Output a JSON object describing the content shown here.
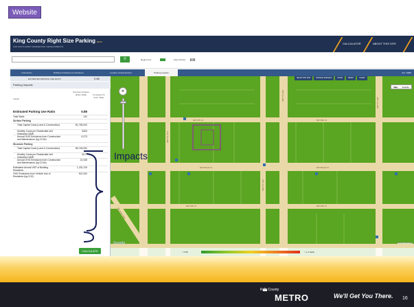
{
  "slide": {
    "badge": "Website",
    "annotation": "Impacts",
    "footer": {
      "logo_top": "King County",
      "logo_bottom": "METRO",
      "tagline": "We'll Get You There.",
      "page_number": "16"
    }
  },
  "app": {
    "title": "King County Right Size Parking",
    "beta": "BETA",
    "subtitle": "FOR MULTI-FAMILY RESIDENTIAL DEVELOPMENTS",
    "topnav": [
      "CALCULATOR",
      "ABOUT THIS SITE"
    ],
    "search": {
      "placeholder": "",
      "button_icon": "search-icon"
    },
    "legend": [
      {
        "label": "Region Ave",
        "color": "#3a9a3a"
      },
      {
        "label": "Zone Priority",
        "color": "#555555"
      }
    ],
    "tabs": [
      {
        "label": "Instructions",
        "active": false
      },
      {
        "label": "Building & Parking Combinations",
        "active": false
      },
      {
        "label": "Location Characteristics",
        "active": false
      },
      {
        "label": "Parking Impacts",
        "active": true
      }
    ],
    "all_tabs_label": "ALL TABS",
    "map_toolbar": [
      "SELECTION MAP",
      "MANAGE PARCELS",
      "ZOOM",
      "RESET",
      "CLEAR"
    ],
    "map_type": [
      "Map",
      "Satellite"
    ]
  },
  "panel": {
    "header_label": "ESTIMATED PARKING USE RATIO",
    "header_value": "0.88",
    "title": "Parking Impacts",
    "col_heads": [
      "Impact",
      "Scenario Analysis (Enter Data)",
      "Compared To Scen. Base"
    ],
    "rows": [
      {
        "label": "Estimated Parking Use Ratio",
        "value": "0.88",
        "kind": "highlight"
      },
      {
        "label": "Total Stalls",
        "value": "132",
        "kind": "normal"
      },
      {
        "label": "Surface Parking",
        "value": "",
        "kind": "section"
      },
      {
        "label": "Total Capital Costs (Land & Construction)",
        "value": "$1,755,000",
        "kind": "sub"
      },
      {
        "label": "Monthly Costs per Residential Unit (including O&M)",
        "value": "$153",
        "kind": "sub"
      },
      {
        "label": "Annual GHG Emissions from Construction and Maintenance (kg CO2e)",
        "value": "6,373",
        "kind": "sub"
      },
      {
        "label": "Structure Parking",
        "value": "",
        "kind": "section"
      },
      {
        "label": "Total Capital Costs (Land & Construction)",
        "value": "$5,745,000",
        "kind": "sub"
      },
      {
        "label": "Monthly Costs per Residential Unit (including O&M)",
        "value": "$177",
        "kind": "sub"
      },
      {
        "label": "Annual GHG Emissions from Construction and Maintenance (kg CO2e)",
        "value": "22,338",
        "kind": "sub"
      },
      {
        "label": "Estimated Annual VMT of Building Residents",
        "value": "1,232,125",
        "kind": "normal"
      },
      {
        "label": "GHG Emissions from Vehicle Use of Residents (kg CO2)",
        "value": "521,000",
        "kind": "normal"
      }
    ],
    "recalc_label": "CALCULATE"
  },
  "map": {
    "google_label": "Google",
    "attribution": "Map data ©2013 Google",
    "scale_min": "< 0.88",
    "scale_max": "> 1.2 Stalls",
    "street_labels": [
      "NW 57th St",
      "NW 56th St",
      "NW Market St",
      "NW Market St",
      "NW 54th St",
      "NW 54th St",
      "15th Ave NW",
      "17th Ave NW",
      "20th Ave NW",
      "24th Ave NW",
      "NW Leary Way"
    ]
  },
  "colors": {
    "map_green": "#5aa521",
    "road_color": "#ead9a8",
    "annotation_blue": "#121a55",
    "footer_dark": "#1d1d26"
  }
}
